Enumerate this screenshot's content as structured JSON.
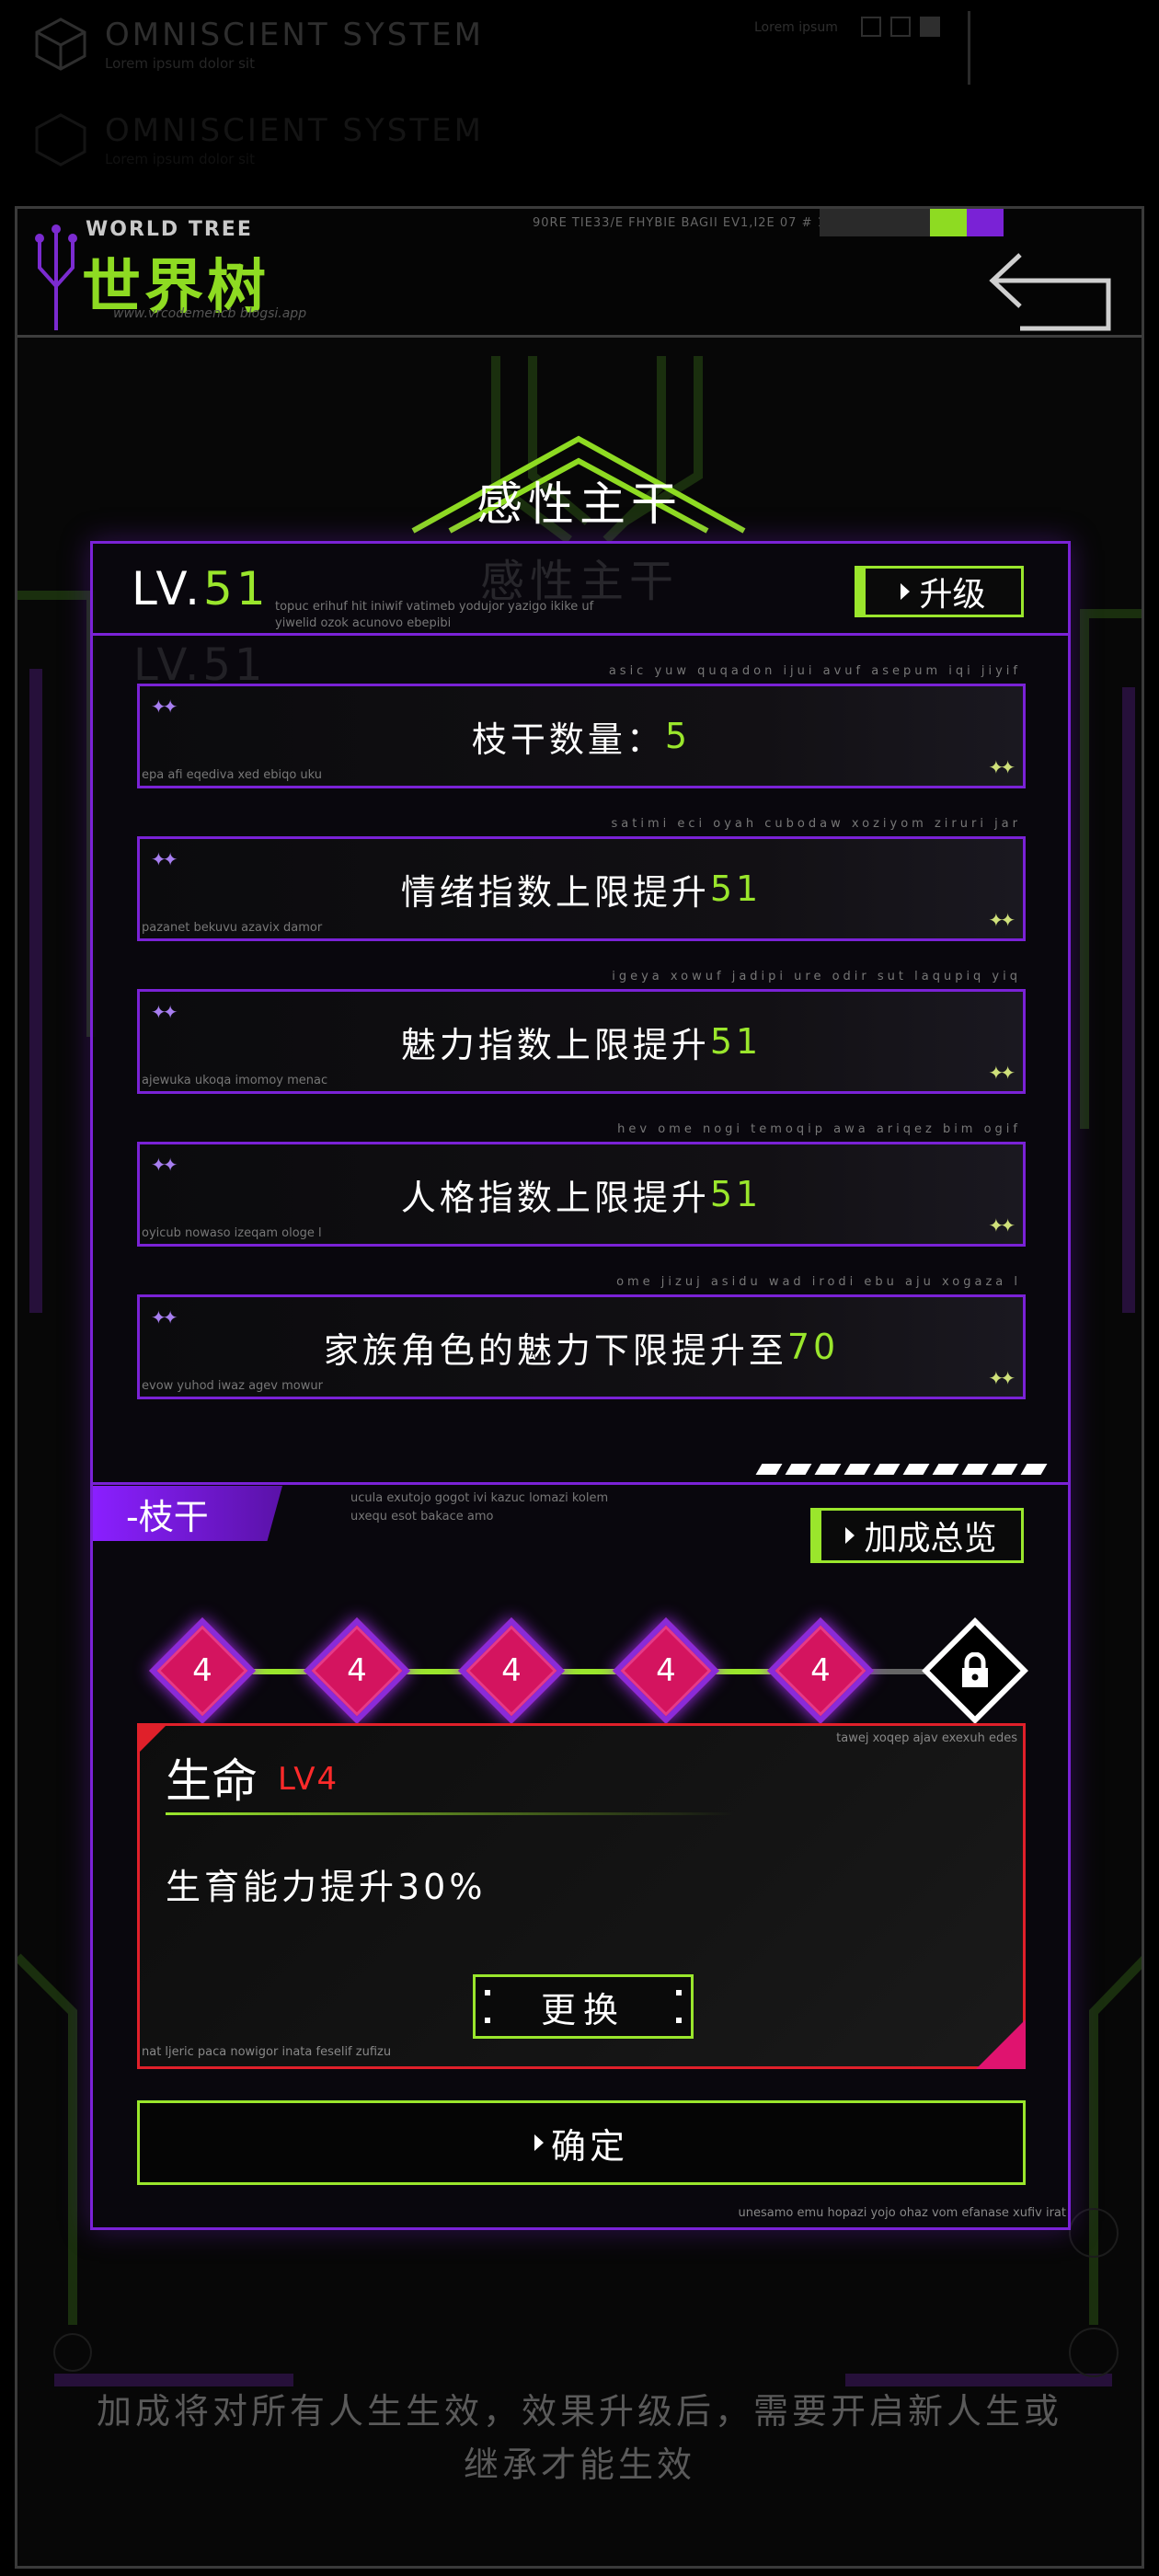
{
  "system": {
    "name": "OMNISCIENT SYSTEM",
    "subtitle": "Lorem ipsum dolor sit",
    "top_right_text": "Lorem ipsum"
  },
  "world_tree": {
    "label": "WORLD TREE",
    "title": "世界树",
    "url_text": "www.vrcodemencb blogsi.app",
    "top_strip_text": "90RE TIE33/E FHYBIE BAGII EV1,I2E 07 # 10"
  },
  "page_title": "感性主干",
  "level": {
    "prefix": "LV.",
    "value": "51",
    "sub_line1": "topuc erihuf hit iniwif vatimeb yodujor yazigo ikike uf",
    "sub_line2": "yiwelid ozok acunovo ebepibi",
    "upgrade_label": "升级"
  },
  "stats": [
    {
      "label": "枝干数量：",
      "value": "5",
      "tiny_top": "asic yuw quqadon ijui avuf asepum iqi jiyif",
      "tiny_bottom": "epa afi eqediva xed ebiqo uku"
    },
    {
      "label": "情绪指数上限提升",
      "value": "51",
      "tiny_top": "satimi eci oyah cubodaw xoziyom ziruri jar",
      "tiny_bottom": "pazanet bekuvu azavix damor"
    },
    {
      "label": "魅力指数上限提升",
      "value": "51",
      "tiny_top": "igeya xowuf jadipi ure odir sut laqupiq yiq",
      "tiny_bottom": "ajewuka ukoqa imomoy menac"
    },
    {
      "label": "人格指数上限提升",
      "value": "51",
      "tiny_top": "hev ome nogi temoqip awa ariqez bim ogif",
      "tiny_bottom": "oyicub nowaso izeqam ologe l"
    },
    {
      "label": "家族角色的魅力下限提升至",
      "value": "70",
      "tiny_top": "ome jizuj asidu wad irodi ebu aju xogaza l",
      "tiny_bottom": "evow yuhod iwaz agev mowur"
    }
  ],
  "branch": {
    "tab_label": "-枝干",
    "tiny_line1": "ucula exutojo gogot ivi kazuc lomazi kolem",
    "tiny_line2": "uxequ esot bakace amo",
    "overview_label": "加成总览"
  },
  "nodes": [
    {
      "value": "4"
    },
    {
      "value": "4"
    },
    {
      "value": "4"
    },
    {
      "value": "4"
    },
    {
      "value": "4"
    }
  ],
  "skill": {
    "name": "生命",
    "level": "LV4",
    "description": "生育能力提升30%",
    "tiny_top": "tawej xoqep ajav exexuh edes",
    "tiny_bottom": "nat ljeric paca nowigor inata feselif zufizu",
    "change_label": "更换"
  },
  "confirm_label": "确定",
  "panel_footer_tiny": "unesamo emu hopazi yojo ohaz vom efanase xufiv irat",
  "footer_note": "加成将对所有人生生效，效果升级后，需要开启新人生或继承才能生效",
  "colors": {
    "accent_green": "#9ae62c",
    "accent_purple": "#7a22d6",
    "accent_magenta": "#d4145f",
    "accent_red": "#e0202a"
  }
}
